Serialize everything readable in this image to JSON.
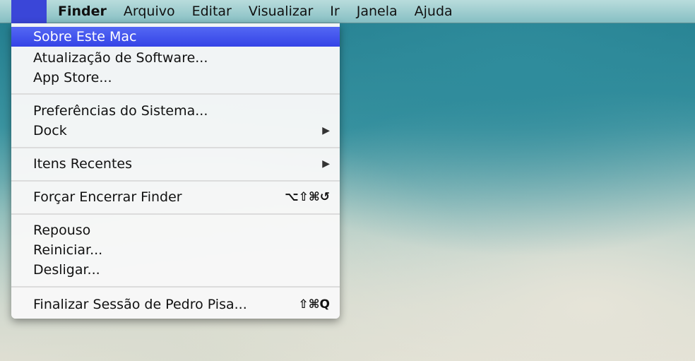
{
  "menubar": {
    "apple": "",
    "items": [
      "Finder",
      "Arquivo",
      "Editar",
      "Visualizar",
      "Ir",
      "Janela",
      "Ajuda"
    ]
  },
  "menu": {
    "sobre": "Sobre Este Mac",
    "atualizacao": "Atualização de Software...",
    "appstore": "App Store...",
    "preferencias": "Preferências do Sistema...",
    "dock": "Dock",
    "recentes": "Itens Recentes",
    "forcar": "Forçar Encerrar Finder",
    "forcar_shortcut": "⌥⇧⌘↺",
    "repouso": "Repouso",
    "reiniciar": "Reiniciar...",
    "desligar": "Desligar...",
    "finalizar": "Finalizar Sessão de Pedro Pisa...",
    "finalizar_shortcut": "⇧⌘Q",
    "submenu_arrow": "▶"
  }
}
